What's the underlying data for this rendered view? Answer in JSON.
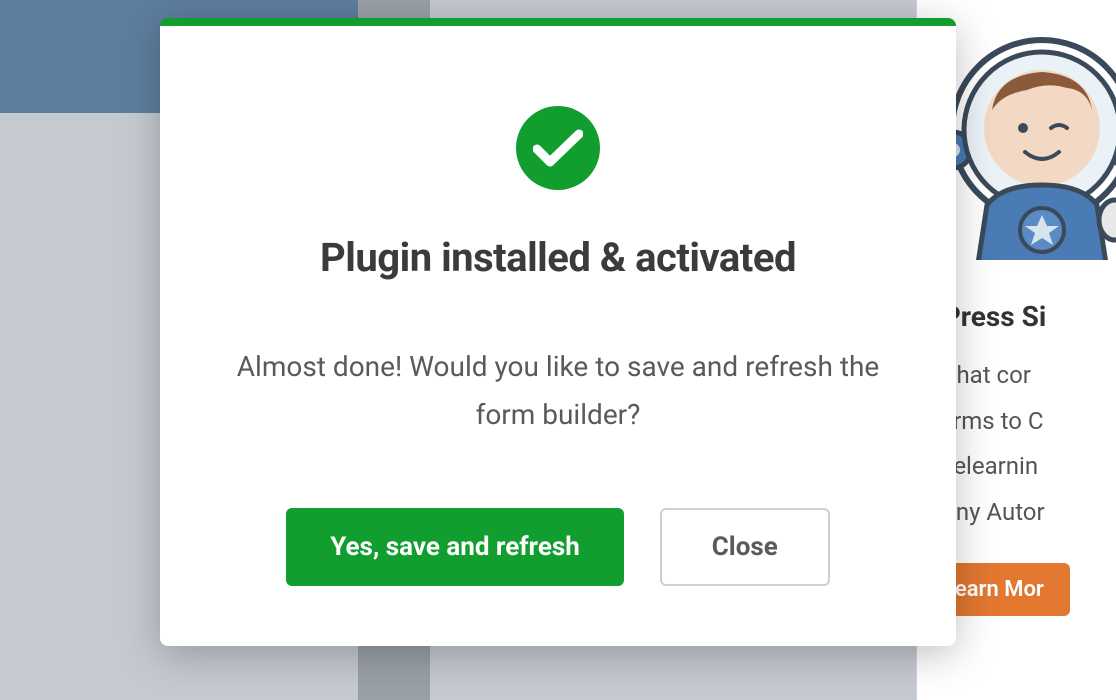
{
  "modal": {
    "title": "Plugin installed & activated",
    "body": "Almost done! Would you like to save and refresh the form builder?",
    "primary_label": "Yes, save and refresh",
    "secondary_label": "Close"
  },
  "background": {
    "right_title": "rdPress Si",
    "right_line1": "ns that cor",
    "right_line2": "r forms to C",
    "right_line3": "ns, elearnin",
    "right_line4": "canny Autor",
    "learn_more": "Learn Mor"
  },
  "colors": {
    "accent_green": "#119e2f",
    "orange": "#e27730",
    "header_blue": "#5e7e9e"
  }
}
